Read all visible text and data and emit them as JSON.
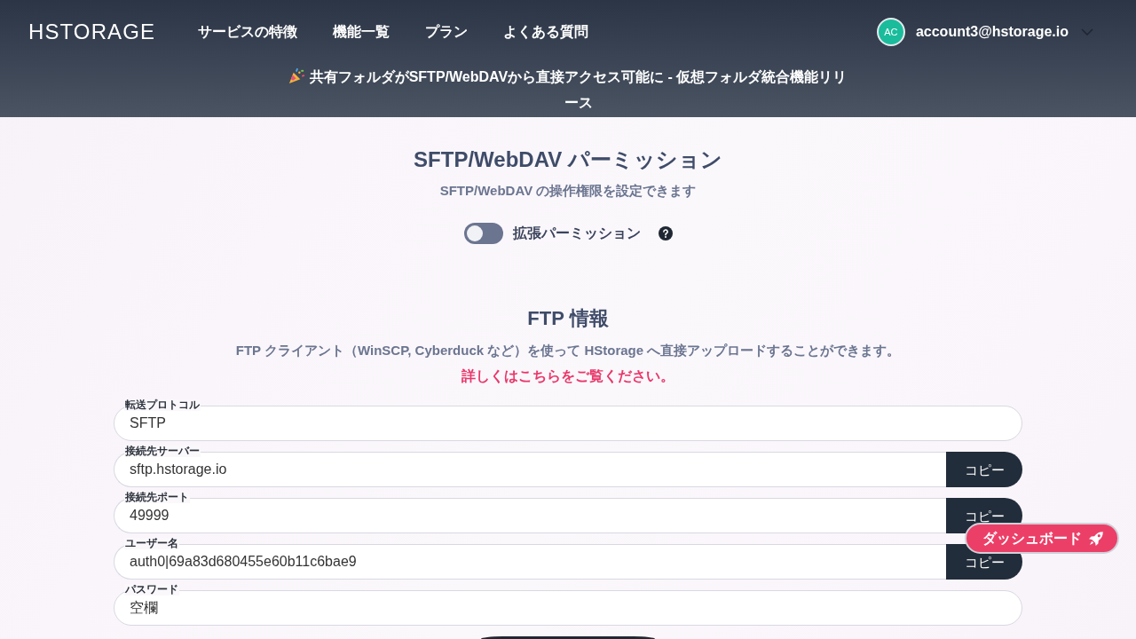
{
  "header": {
    "logo": "HSTORAGE",
    "nav": [
      "サービスの特徴",
      "機能一覧",
      "プラン",
      "よくある質問"
    ],
    "account": {
      "avatar_initials": "AC",
      "email": "account3@hstorage.io"
    }
  },
  "announcement": {
    "text": "共有フォルダがSFTP/WebDAVから直接アクセス可能に - 仮想フォルダ統合機能リリース"
  },
  "permissions": {
    "title": "SFTP/WebDAV パーミッション",
    "subtitle": "SFTP/WebDAV の操作権限を設定できます",
    "toggle": {
      "label": "拡張パーミッション",
      "on": false
    }
  },
  "ftp_info": {
    "title": "FTP 情報",
    "description": "FTP クライアント（WinSCP, Cyberduck など）を使って HStorage へ直接アップロードすることができます。",
    "link": "詳しくはこちらをご覧ください。",
    "fields": [
      {
        "label": "転送プロトコル",
        "value": "SFTP"
      },
      {
        "label": "接続先サーバー",
        "value": "sftp.hstorage.io",
        "copy_button": "コピー"
      },
      {
        "label": "接続先ポート",
        "value": "49999",
        "copy_button": "コピー"
      },
      {
        "label": "ユーザー名",
        "value": "auth0|69a83d680455e60b11c6bae9",
        "copy_button": "コピー"
      },
      {
        "label": "パスワード",
        "value": "空欄"
      }
    ]
  },
  "dashboard_button": {
    "label": "ダッシュボード"
  }
}
